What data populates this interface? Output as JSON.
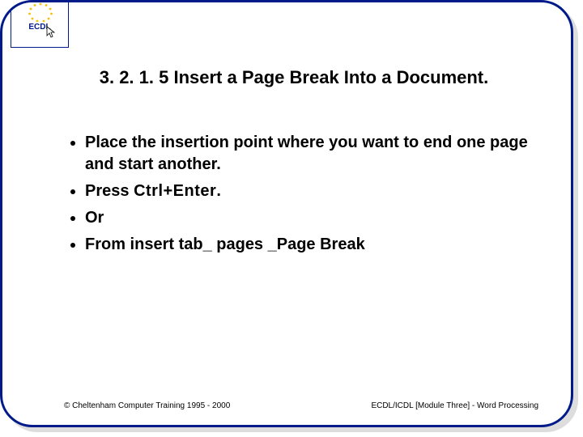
{
  "logo": {
    "label": "ECDL",
    "caption1": "",
    "caption2": ""
  },
  "title": "3. 2. 1. 5 Insert a Page Break Into a Document.",
  "bullets": [
    {
      "prefix": "Place the insertion point where you want to end one page and start another.",
      "code": "",
      "suffix": ""
    },
    {
      "prefix": "Press ",
      "code": "Ctrl+Enter",
      "suffix": "."
    },
    {
      "prefix": "Or",
      "code": "",
      "suffix": ""
    },
    {
      "prefix": "From insert tab_ pages _Page Break",
      "code": "",
      "suffix": ""
    }
  ],
  "footer": {
    "left": "© Cheltenham Computer Training 1995 - 2000",
    "right": "ECDL/ICDL [Module Three]  - Word Processing"
  }
}
